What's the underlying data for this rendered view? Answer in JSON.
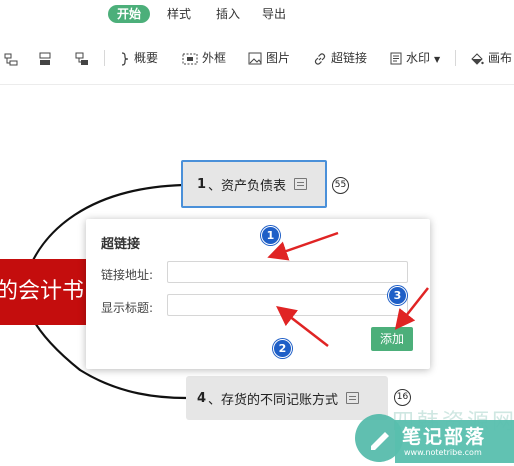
{
  "menu": {
    "tabs": [
      {
        "label": "开始",
        "active": true
      },
      {
        "label": "样式",
        "active": false
      },
      {
        "label": "插入",
        "active": false
      },
      {
        "label": "导出",
        "active": false
      }
    ]
  },
  "toolbar": {
    "summary_label": "概要",
    "frame_label": "外框",
    "image_label": "图片",
    "hyperlink_label": "超链接",
    "watermark_label": "水印",
    "canvas_label": "画布"
  },
  "mindmap": {
    "root_text": "的会计书",
    "node1": {
      "number": "1",
      "text": "、资产负债表",
      "count": "55"
    },
    "node4": {
      "number": "4",
      "text": "、存货的不同记账方式",
      "count": "16"
    }
  },
  "hyperlink_dialog": {
    "title": "超链接",
    "address_label": "链接地址:",
    "address_value": "",
    "display_label": "显示标题:",
    "display_value": "",
    "add_button": "添加"
  },
  "annotations": {
    "badge1": "1",
    "badge2": "2",
    "badge3": "3"
  },
  "watermark": {
    "main": "笔记部落",
    "background_text": "四韩资源网",
    "url": "www.notetribe.com"
  },
  "colors": {
    "accent_green": "#4caf7a",
    "root_red": "#c40d0d",
    "arrow_red": "#e02424",
    "badge_blue": "#1f5fc7",
    "selection_blue": "#4a90d9"
  }
}
